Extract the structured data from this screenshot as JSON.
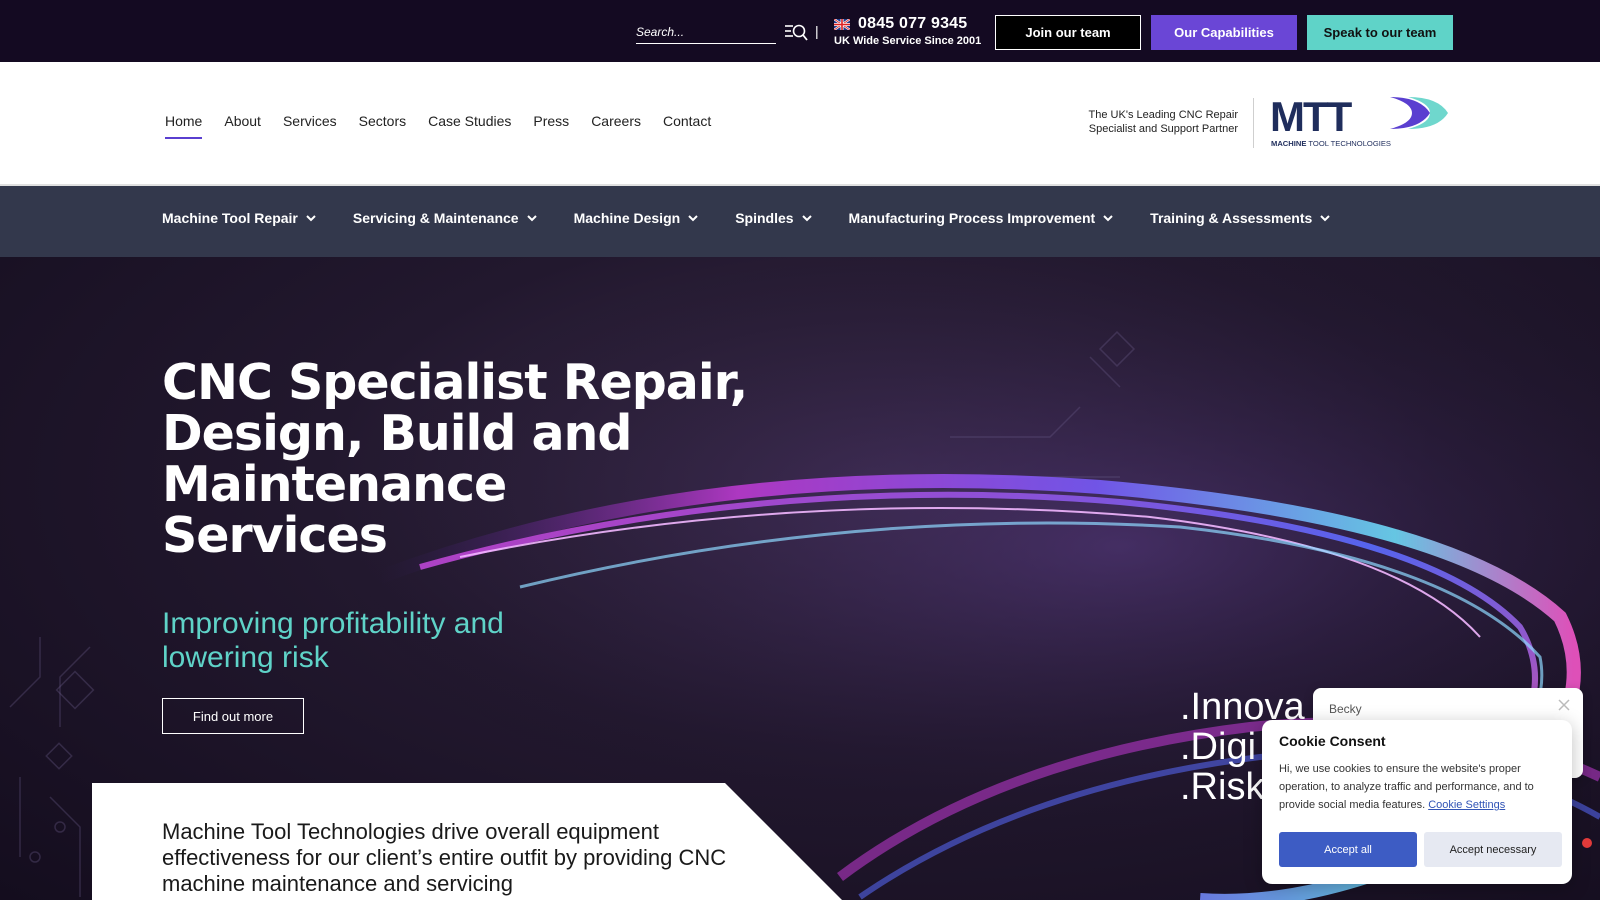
{
  "topbar": {
    "search_placeholder": "Search...",
    "divider": "|",
    "phone": "0845 077 9345",
    "phone_sub": "UK Wide Service Since 2001",
    "buttons": {
      "join": "Join our team",
      "capabilities": "Our Capabilities",
      "speak": "Speak to our team"
    }
  },
  "nav": {
    "items": [
      {
        "label": "Home",
        "active": true
      },
      {
        "label": "About"
      },
      {
        "label": "Services"
      },
      {
        "label": "Sectors"
      },
      {
        "label": "Case Studies"
      },
      {
        "label": "Press"
      },
      {
        "label": "Careers"
      },
      {
        "label": "Contact"
      }
    ],
    "tagline_line1": "The UK's Leading CNC Repair",
    "tagline_line2": "Specialist and Support Partner"
  },
  "logo": {
    "letters": "MTT",
    "subtitle_bold": "MACHINE",
    "subtitle_rest": " TOOL TECHNOLOGIES"
  },
  "subnav": {
    "items": [
      "Machine Tool Repair",
      "Servicing & Maintenance",
      "Machine Design",
      "Spindles",
      "Manufacturing Process Improvement",
      "Training & Assessments"
    ]
  },
  "hero": {
    "title_line1": "CNC Specialist Repair,",
    "title_line2": "Design, Build and Maintenance",
    "title_line3": "Services",
    "subtitle_line1": "Improving profitability and",
    "subtitle_line2": "lowering risk",
    "cta": "Find out more",
    "overlay_words": [
      ".Innova",
      ".Digi",
      ".Risk"
    ]
  },
  "content": {
    "line1": "Machine Tool Technologies drive overall equipment",
    "line2": "effectiveness  for our client’s entire outfit by providing CNC",
    "line3": "machine maintenance and servicing"
  },
  "chat": {
    "name": "Becky"
  },
  "cookie": {
    "title": "Cookie Consent",
    "text": "Hi, we use cookies to ensure the website's proper operation, to analyze traffic and performance, and to provide social media features. ",
    "link": "Cookie Settings",
    "accept_all": "Accept all",
    "accept_necessary": "Accept necessary"
  },
  "colors": {
    "topbar": "#140a22",
    "accent_purple": "#6a46d6",
    "accent_teal": "#5fd3c8",
    "subnav": "#33384c",
    "logo_navy": "#1f2d5c",
    "cookie_button": "#3d5cc4"
  },
  "icons": [
    "search-icon",
    "uk-flag-icon",
    "chevron-down-icon",
    "close-icon"
  ]
}
